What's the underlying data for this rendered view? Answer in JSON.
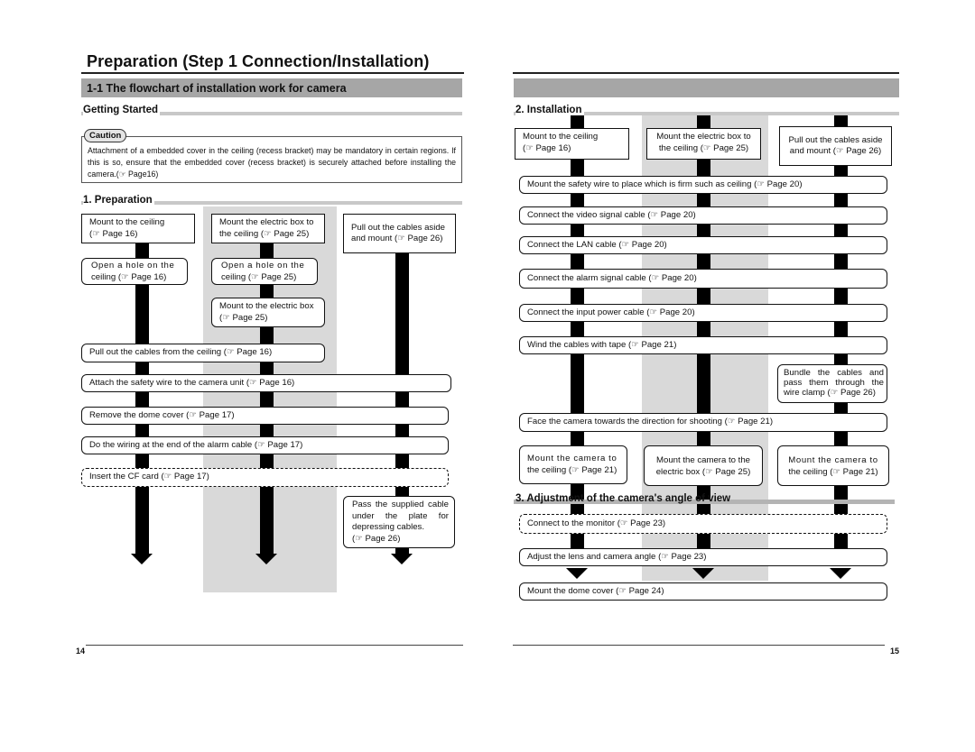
{
  "header": {
    "main_title": "Preparation (Step 1 Connection/Installation)",
    "band_title": "1-1 The flowchart of installation work for camera",
    "getting_started": "Getting Started"
  },
  "caution": {
    "tag": "Caution",
    "text": "Attachment of a embedded cover in the ceiling (recess bracket) may be mandatory in certain regions. If this is so, ensure that the embedded cover (recess bracket) is securely attached before installing the camera.(☞ Page16)"
  },
  "preparation": {
    "heading": "1. Preparation",
    "col1_top": [
      "Mount to the ceiling",
      "(☞ Page 16)"
    ],
    "col2_top": [
      "Mount the electric box to",
      "the ceiling (☞ Page 25)"
    ],
    "col3_top": [
      "Pull out the cables aside",
      "and mount (☞ Page 26)"
    ],
    "col1_hole": [
      "Open a hole on the",
      "ceiling (☞ Page 16)"
    ],
    "col2_hole": [
      "Open a hole on the",
      "ceiling (☞ Page 25)"
    ],
    "col2_mount_box": [
      "Mount to the electric box",
      "(☞ Page 25)"
    ],
    "pull_cables": "Pull out the cables from the ceiling (☞ Page 16)",
    "attach_wire": "Attach the safety wire to the camera unit (☞ Page 16)",
    "remove_dome": "Remove the dome cover (☞ Page 17)",
    "wiring_alarm": "Do the wiring at the end of the alarm cable (☞ Page 17)",
    "insert_cf": "Insert the CF card (☞ Page 17)",
    "col3_pass_cable": [
      "Pass the supplied cable under the plate for depressing cables.",
      "(☞ Page 26)"
    ]
  },
  "installation": {
    "heading": "2. Installation",
    "col1_top": [
      "Mount to the ceiling",
      "(☞ Page 16)"
    ],
    "col2_top": [
      "Mount the electric box to",
      "the ceiling (☞ Page 25)"
    ],
    "col3_top": [
      "Pull out the cables aside",
      "and mount (☞ Page 26)"
    ],
    "safety_wire": "Mount the safety wire to place which is firm such as ceiling (☞ Page 20)",
    "video_cable": "Connect the video signal cable (☞ Page 20)",
    "lan_cable": "Connect the LAN cable (☞ Page 20)",
    "alarm_cable": "Connect the alarm signal cable (☞ Page 20)",
    "power_cable": "Connect the input power cable (☞ Page 20)",
    "wind_tape": "Wind the cables with tape (☞ Page 21)",
    "col3_bundle": "Bundle the cables and pass them through the wire clamp (☞ Page 26)",
    "face_camera": "Face the camera towards the direction for shooting (☞ Page 21)",
    "col1_mount_camera": [
      "Mount the camera to",
      "the ceiling (☞ Page 21)"
    ],
    "col2_mount_camera": [
      "Mount the camera to the",
      "electric box (☞ Page 25)"
    ],
    "col3_mount_camera": [
      "Mount the camera to",
      "the ceiling (☞ Page 21)"
    ]
  },
  "adjustment": {
    "heading": "3. Adjustment of the camera's angle of view",
    "monitor": "Connect to the monitor (☞ Page 23)",
    "lens": "Adjust the lens and camera angle (☞ Page 23)",
    "dome": "Mount the dome cover (☞ Page 24)"
  },
  "footer": {
    "left_page": "14",
    "right_page": "15"
  }
}
